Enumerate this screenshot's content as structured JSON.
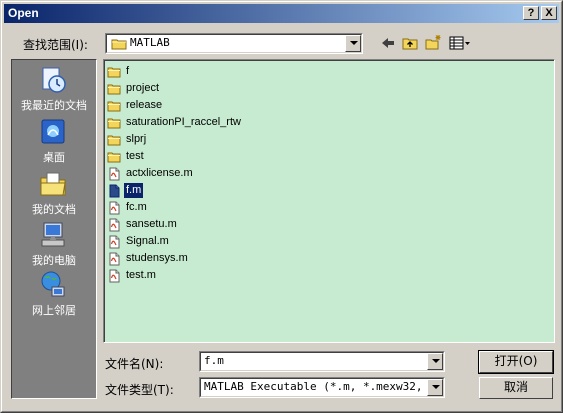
{
  "window": {
    "title": "Open",
    "help_button": "?",
    "close_button": "X"
  },
  "lookin": {
    "label": "查找范围(I):",
    "value": "MATLAB"
  },
  "places": [
    {
      "label": "我最近的文档",
      "icon": "recent-documents-icon"
    },
    {
      "label": "桌面",
      "icon": "desktop-icon"
    },
    {
      "label": "我的文档",
      "icon": "my-documents-icon"
    },
    {
      "label": "我的电脑",
      "icon": "my-computer-icon"
    },
    {
      "label": "网上邻居",
      "icon": "network-places-icon"
    }
  ],
  "files": [
    {
      "name": "f",
      "type": "folder"
    },
    {
      "name": "project",
      "type": "folder"
    },
    {
      "name": "release",
      "type": "folder"
    },
    {
      "name": "saturationPI_raccel_rtw",
      "type": "folder"
    },
    {
      "name": "slprj",
      "type": "folder"
    },
    {
      "name": "test",
      "type": "folder"
    },
    {
      "name": "actxlicense.m",
      "type": "m-file"
    },
    {
      "name": "f.m",
      "type": "m-file",
      "selected": true
    },
    {
      "name": "fc.m",
      "type": "m-file"
    },
    {
      "name": "sansetu.m",
      "type": "m-file"
    },
    {
      "name": "Signal.m",
      "type": "m-file"
    },
    {
      "name": "studensys.m",
      "type": "m-file"
    },
    {
      "name": "test.m",
      "type": "m-file"
    }
  ],
  "filename": {
    "label": "文件名(N):",
    "value": "f.m"
  },
  "filetype": {
    "label": "文件类型(T):",
    "value": "MATLAB Executable (*.m, *.mexw32, *.p"
  },
  "buttons": {
    "open": "打开(O)",
    "cancel": "取消"
  },
  "colors": {
    "title_start": "#0a246a",
    "title_end": "#a6caf0",
    "list_bg": "#c7ebd0",
    "selection": "#0a246a"
  }
}
